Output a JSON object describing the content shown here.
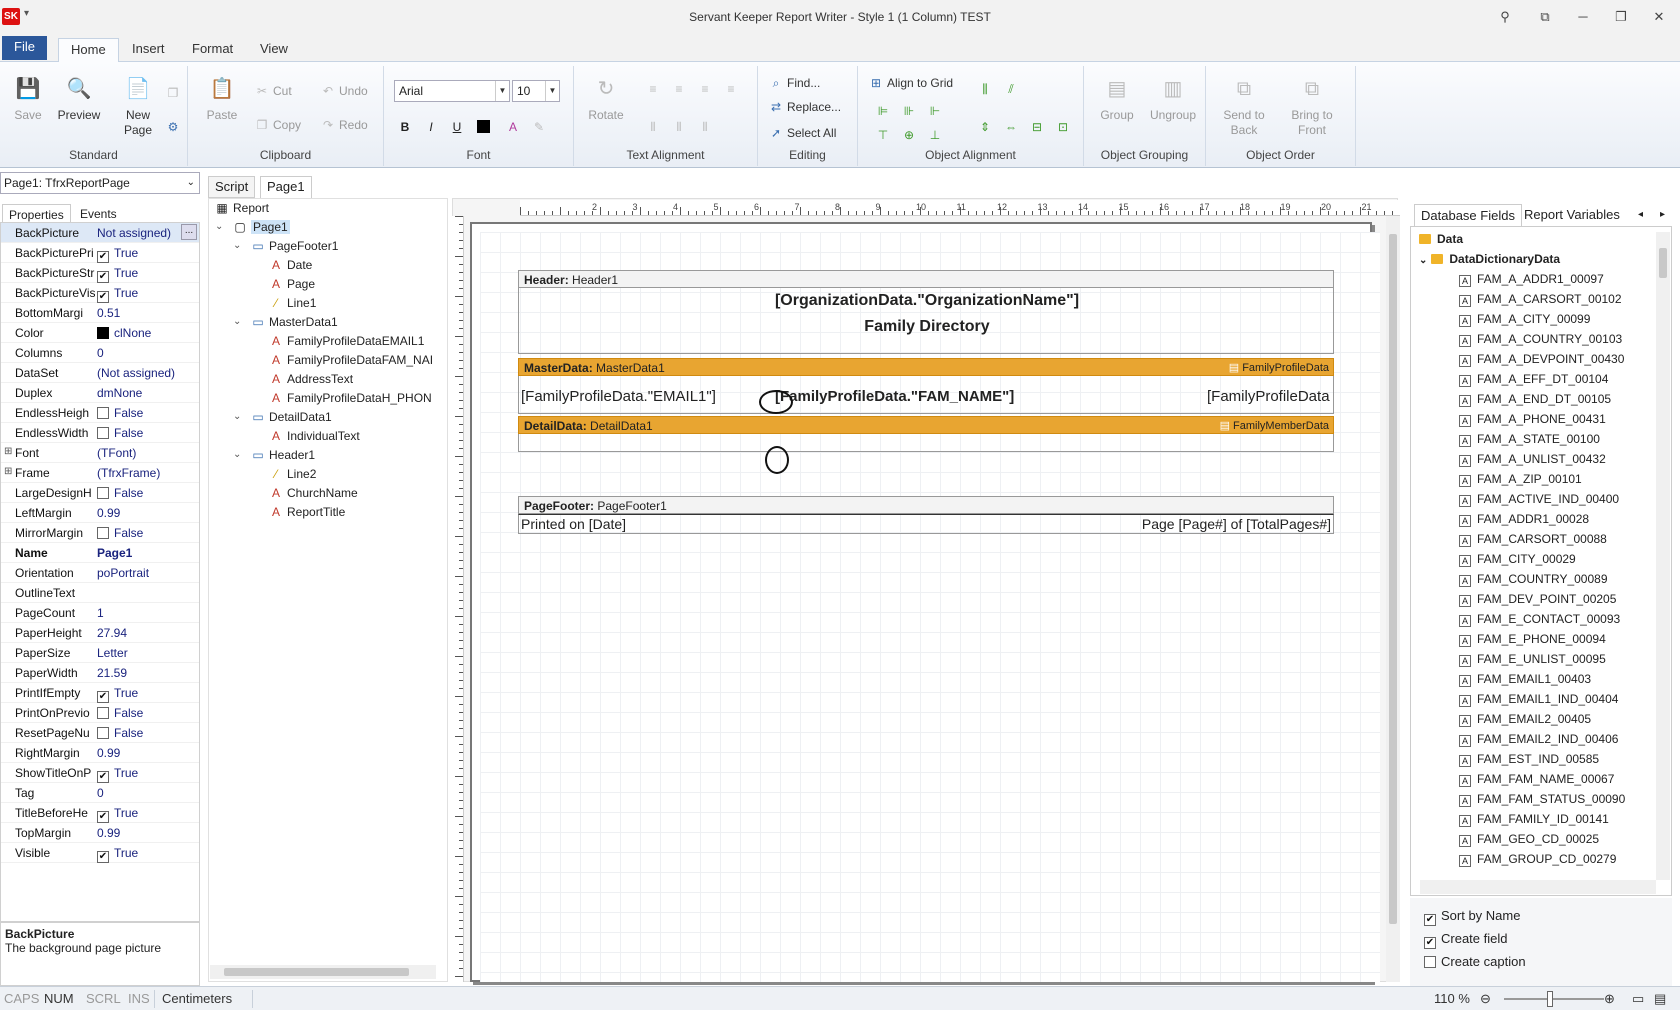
{
  "window": {
    "title": "Servant Keeper Report Writer - Style 1 (1 Column) TEST",
    "logo": "SK"
  },
  "menu": {
    "tabs": [
      "File",
      "Home",
      "Insert",
      "Format",
      "View"
    ]
  },
  "ribbon": {
    "standard": {
      "label": "Standard",
      "save": "Save",
      "preview": "Preview",
      "new_page": "New Page"
    },
    "clipboard": {
      "label": "Clipboard",
      "paste": "Paste",
      "cut": "Cut",
      "copy": "Copy",
      "undo": "Undo",
      "redo": "Redo"
    },
    "font": {
      "label": "Font",
      "family": "Arial",
      "size": "10",
      "bold": "B",
      "italic": "I",
      "underline": "U"
    },
    "text_alignment": {
      "label": "Text Alignment",
      "rotate": "Rotate"
    },
    "editing": {
      "label": "Editing",
      "find": "Find...",
      "replace": "Replace...",
      "select_all": "Select All"
    },
    "object_alignment": {
      "label": "Object Alignment",
      "align_to_grid": "Align to Grid"
    },
    "object_grouping": {
      "label": "Object Grouping",
      "group": "Group",
      "ungroup": "Ungroup"
    },
    "object_order": {
      "label": "Object Order",
      "send_to_back": "Send to Back",
      "bring_to_front": "Bring to Front"
    }
  },
  "properties": {
    "object_selector": "Page1: TfrxReportPage",
    "tabs": [
      "Properties",
      "Events"
    ],
    "rows": [
      {
        "name": "BackPicture",
        "value": "Not assigned)",
        "extra": "..."
      },
      {
        "name": "BackPicturePri",
        "value": "True",
        "check": true
      },
      {
        "name": "BackPictureStr",
        "value": "True",
        "check": true
      },
      {
        "name": "BackPictureVis",
        "value": "True",
        "check": true
      },
      {
        "name": "BottomMargi",
        "value": "0.51"
      },
      {
        "name": "Color",
        "value": "clNone",
        "swatch": true
      },
      {
        "name": "Columns",
        "value": "0"
      },
      {
        "name": "DataSet",
        "value": "(Not assigned)"
      },
      {
        "name": "Duplex",
        "value": "dmNone"
      },
      {
        "name": "EndlessHeigh",
        "value": "False",
        "check": false
      },
      {
        "name": "EndlessWidth",
        "value": "False",
        "check": false
      },
      {
        "name": "Font",
        "value": "(TFont)",
        "expand": true
      },
      {
        "name": "Frame",
        "value": "(TfrxFrame)",
        "expand": true
      },
      {
        "name": "LargeDesignH",
        "value": "False",
        "check": false
      },
      {
        "name": "LeftMargin",
        "value": "0.99"
      },
      {
        "name": "MirrorMargin",
        "value": "False",
        "check": false
      },
      {
        "name": "Name",
        "value": "Page1",
        "bold": true
      },
      {
        "name": "Orientation",
        "value": "poPortrait"
      },
      {
        "name": "OutlineText",
        "value": ""
      },
      {
        "name": "PageCount",
        "value": "1"
      },
      {
        "name": "PaperHeight",
        "value": "27.94"
      },
      {
        "name": "PaperSize",
        "value": "Letter"
      },
      {
        "name": "PaperWidth",
        "value": "21.59"
      },
      {
        "name": "PrintIfEmpty",
        "value": "True",
        "check": true
      },
      {
        "name": "PrintOnPrevio",
        "value": "False",
        "check": false
      },
      {
        "name": "ResetPageNu",
        "value": "False",
        "check": false
      },
      {
        "name": "RightMargin",
        "value": "0.99"
      },
      {
        "name": "ShowTitleOnP",
        "value": "True",
        "check": true
      },
      {
        "name": "Tag",
        "value": "0"
      },
      {
        "name": "TitleBeforeHe",
        "value": "True",
        "check": true
      },
      {
        "name": "TopMargin",
        "value": "0.99"
      },
      {
        "name": "Visible",
        "value": "True",
        "check": true
      }
    ],
    "description": {
      "title": "BackPicture",
      "text": "The background page picture"
    }
  },
  "tree": {
    "tabs": [
      "Script",
      "Page1"
    ],
    "nodes": [
      {
        "label": "Report",
        "level": 0,
        "kind": "report"
      },
      {
        "label": "Page1",
        "level": 1,
        "kind": "page",
        "exp": "v"
      },
      {
        "label": "PageFooter1",
        "level": 2,
        "kind": "band",
        "exp": "v"
      },
      {
        "label": "Date",
        "level": 3,
        "kind": "text"
      },
      {
        "label": "Page",
        "level": 3,
        "kind": "text"
      },
      {
        "label": "Line1",
        "level": 3,
        "kind": "line"
      },
      {
        "label": "MasterData1",
        "level": 2,
        "kind": "band",
        "exp": "v"
      },
      {
        "label": "FamilyProfileDataEMAIL1",
        "level": 3,
        "kind": "text"
      },
      {
        "label": "FamilyProfileDataFAM_NAI",
        "level": 3,
        "kind": "text"
      },
      {
        "label": "AddressText",
        "level": 3,
        "kind": "text"
      },
      {
        "label": "FamilyProfileDataH_PHON",
        "level": 3,
        "kind": "text"
      },
      {
        "label": "DetailData1",
        "level": 2,
        "kind": "band",
        "exp": "v"
      },
      {
        "label": "IndividualText",
        "level": 3,
        "kind": "text"
      },
      {
        "label": "Header1",
        "level": 2,
        "kind": "band",
        "exp": "v"
      },
      {
        "label": "Line2",
        "level": 3,
        "kind": "line"
      },
      {
        "label": "ChurchName",
        "level": 3,
        "kind": "text"
      },
      {
        "label": "ReportTitle",
        "level": 3,
        "kind": "text"
      }
    ]
  },
  "canvas": {
    "header": {
      "label": "Header:",
      "name": "Header1",
      "org_name": "[OrganizationData.\"OrganizationName\"]",
      "title": "Family Directory"
    },
    "master": {
      "label": "MasterData:",
      "name": "MasterData1",
      "dataset": "FamilyProfileData",
      "email": "[FamilyProfileData.\"EMAIL1\"]",
      "fam_name": "[FamilyProfileData.\"FAM_NAME\"]",
      "right_field": "[FamilyProfileData"
    },
    "detail": {
      "label": "DetailData:",
      "name": "DetailData1",
      "dataset": "FamilyMemberData"
    },
    "footer": {
      "label": "PageFooter:",
      "name": "PageFooter1",
      "printed": "Printed on [Date]",
      "page": "Page [Page#] of [TotalPages#]"
    },
    "ruler_numbers": [
      "2",
      "3",
      "4",
      "5",
      "6",
      "7",
      "8",
      "9",
      "10",
      "11",
      "12",
      "13",
      "14",
      "15",
      "16",
      "17",
      "18",
      "19",
      "20",
      "21"
    ]
  },
  "database": {
    "tabs": [
      "Database Fields",
      "Report Variables"
    ],
    "root": "Data",
    "dictionary": "DataDictionaryData",
    "fields": [
      "FAM_A_ADDR1_00097",
      "FAM_A_CARSORT_00102",
      "FAM_A_CITY_00099",
      "FAM_A_COUNTRY_00103",
      "FAM_A_DEVPOINT_00430",
      "FAM_A_EFF_DT_00104",
      "FAM_A_END_DT_00105",
      "FAM_A_PHONE_00431",
      "FAM_A_STATE_00100",
      "FAM_A_UNLIST_00432",
      "FAM_A_ZIP_00101",
      "FAM_ACTIVE_IND_00400",
      "FAM_ADDR1_00028",
      "FAM_CARSORT_00088",
      "FAM_CITY_00029",
      "FAM_COUNTRY_00089",
      "FAM_DEV_POINT_00205",
      "FAM_E_CONTACT_00093",
      "FAM_E_PHONE_00094",
      "FAM_E_UNLIST_00095",
      "FAM_EMAIL1_00403",
      "FAM_EMAIL1_IND_00404",
      "FAM_EMAIL2_00405",
      "FAM_EMAIL2_IND_00406",
      "FAM_EST_IND_00585",
      "FAM_FAM_NAME_00067",
      "FAM_FAM_STATUS_00090",
      "FAM_FAMILY_ID_00141",
      "FAM_GEO_CD_00025",
      "FAM_GROUP_CD_00279"
    ],
    "options": [
      {
        "label": "Sort by Name",
        "checked": true
      },
      {
        "label": "Create field",
        "checked": true
      },
      {
        "label": "Create caption",
        "checked": false
      }
    ]
  },
  "status": {
    "caps": "CAPS",
    "num": "NUM",
    "scrl": "SCRL",
    "ins": "INS",
    "units": "Centimeters",
    "zoom": "110 %"
  }
}
